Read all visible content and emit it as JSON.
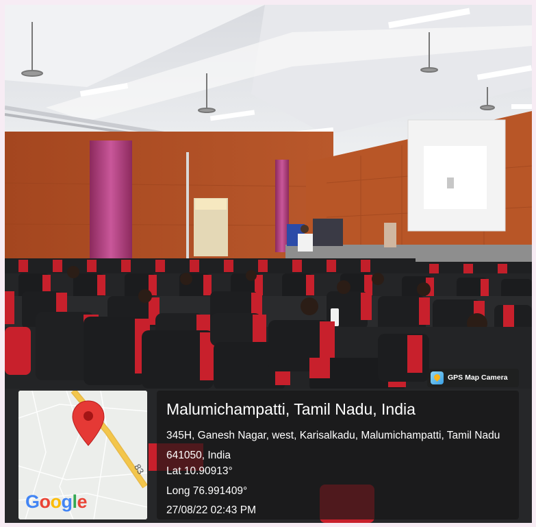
{
  "photo": {
    "description_colors": {
      "wall": "#b4532a",
      "ceiling": "#e6e7ea",
      "seat_red": "#c8202c",
      "seat_black": "#222426",
      "curtain": "#b23a7a",
      "floor": "#7f7f7f"
    }
  },
  "map": {
    "logo": "Google",
    "road_number": "83",
    "pin_icon": "map-pin-icon",
    "pin_color": "#e53935",
    "road_color": "#f3c64b"
  },
  "location": {
    "title": "Malumichampatti, Tamil Nadu, India",
    "address": "345H, Ganesh Nagar, west, Karisalkadu, Malumichampatti, Tamil Nadu 641050, India",
    "lat": "Lat 10.90913°",
    "long": "Long 76.991409°",
    "datetime": "27/08/22 02:43 PM"
  },
  "badge": {
    "label": "GPS Map Camera",
    "icon": "gps-map-camera-icon"
  }
}
